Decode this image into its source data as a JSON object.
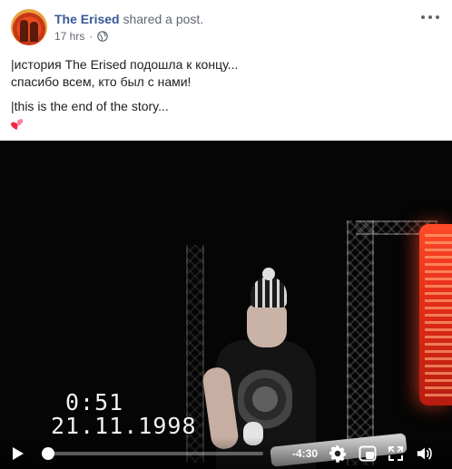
{
  "post": {
    "author": "The Erised",
    "action": "shared a post.",
    "time": "17 hrs",
    "separator": "·",
    "privacy_icon": "globe-icon",
    "more_icon": "more-options-icon",
    "text_ru_line1": "|история The Erised подошла к концу...",
    "text_ru_line2": "спасибо всем, кто был с нами!",
    "text_en": "|this is the end of the story...",
    "emoji_icon": "two-hearts-icon"
  },
  "video": {
    "overlay_time": "0:51",
    "overlay_date": "21.11.1998",
    "time_remaining": "-4:30",
    "progress": 0.02,
    "icons": [
      "play-icon",
      "settings-gear-icon",
      "picture-in-picture-icon",
      "fullscreen-icon",
      "volume-icon"
    ]
  },
  "colors": {
    "author": "#385898",
    "meta": "#606770",
    "text": "#1c1e21",
    "heart": "#f02849"
  }
}
